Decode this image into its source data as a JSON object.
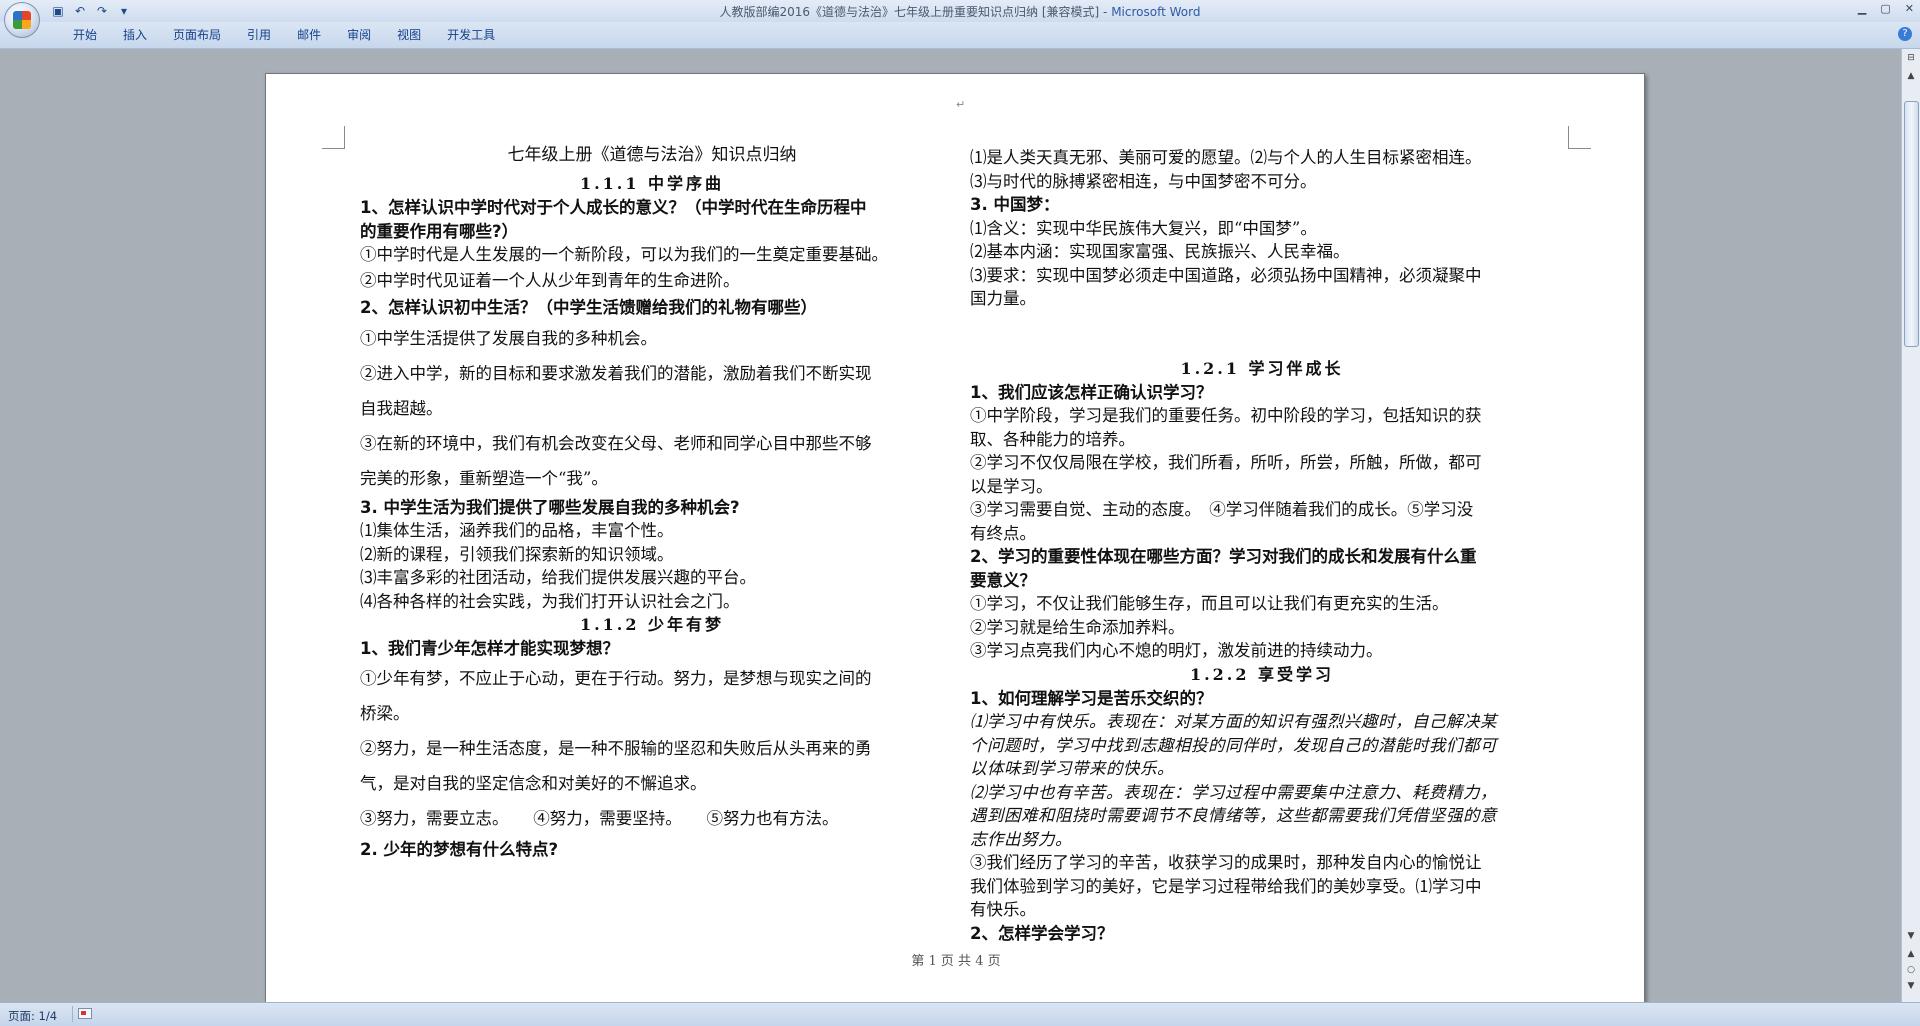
{
  "window": {
    "title": "人教版部编2016《道德与法治》七年级上册重要知识点归纳 [兼容模式] - ",
    "app_name": "Microsoft Word"
  },
  "quick_access": [
    "save-icon",
    "undo-icon",
    "redo-icon",
    "customize-icon"
  ],
  "ribbon": {
    "tabs": [
      "开始",
      "插入",
      "页面布局",
      "引用",
      "邮件",
      "审阅",
      "视图",
      "开发工具"
    ]
  },
  "document": {
    "left_column": [
      {
        "t": "七年级上册《道德与法治》知识点归纳",
        "cls": "doc-title"
      },
      {
        "t": "1.1.1 中学序曲",
        "cls": "sec-h"
      },
      {
        "t": "1、怎样认识中学时代对于个人成长的意义？（中学时代在生命历程中",
        "cls": "ln b"
      },
      {
        "t": "的重要作用有哪些?）",
        "cls": "ln b"
      },
      {
        "t": "①中学时代是人生发展的一个新阶段，可以为我们的一生奠定重要基础。",
        "cls": "ln"
      },
      {
        "t": "②中学时代见证着一个人从少年到青年的生命进阶。",
        "cls": "ln gap-m"
      },
      {
        "t": "2、怎样认识初中生活？（中学生活馈赠给我们的礼物有哪些）",
        "cls": "ln b gap-m"
      },
      {
        "t": "①中学生活提供了发展自我的多种机会。",
        "cls": "ln gap-l"
      },
      {
        "t": "②进入中学，新的目标和要求激发着我们的潜能，激励着我们不断实现",
        "cls": "ln gap-l"
      },
      {
        "t": "自我超越。",
        "cls": "ln gap-l"
      },
      {
        "t": "③在新的环境中，我们有机会改变在父母、老师和同学心目中那些不够",
        "cls": "ln gap-l"
      },
      {
        "t": "完美的形象，重新塑造一个“我”。",
        "cls": "ln gap-l"
      },
      {
        "t": "3. 中学生活为我们提供了哪些发展自我的多种机会?",
        "cls": "ln b"
      },
      {
        "t": "⑴集体生活，涵养我们的品格，丰富个性。",
        "cls": "ln"
      },
      {
        "t": "⑵新的课程，引领我们探索新的知识领域。",
        "cls": "ln"
      },
      {
        "t": "⑶丰富多彩的社团活动，给我们提供发展兴趣的平台。",
        "cls": "ln"
      },
      {
        "t": "⑷各种各样的社会实践，为我们打开认识社会之门。",
        "cls": "ln"
      },
      {
        "t": "1.1.2 少年有梦",
        "cls": "sec-h"
      },
      {
        "t": "1、我们青少年怎样才能实现梦想？",
        "cls": "ln b"
      },
      {
        "t": "①少年有梦，不应止于心动，更在于行动。努力，是梦想与现实之间的",
        "cls": "ln gap-l"
      },
      {
        "t": "桥梁。",
        "cls": "ln gap-l"
      },
      {
        "t": "②努力，是一种生活态度，是一种不服输的坚忍和失败后从头再来的勇",
        "cls": "ln gap-l"
      },
      {
        "t": "气，是对自我的坚定信念和对美好的不懈追求。",
        "cls": "ln gap-l"
      },
      {
        "t": "③努力，需要立志。　　④努力，需要坚持。　　⑤努力也有方法。",
        "cls": "ln gap-l"
      },
      {
        "t": "2. 少年的梦想有什么特点?",
        "cls": "ln b gap-m"
      }
    ],
    "right_column": [
      {
        "t": "⑴是人类天真无邪、美丽可爱的愿望。⑵与个人的人生目标紧密相连。",
        "cls": "ln"
      },
      {
        "t": "⑶与时代的脉搏紧密相连，与中国梦密不可分。",
        "cls": "ln"
      },
      {
        "t": "3. 中国梦：",
        "cls": "ln b"
      },
      {
        "t": "⑴含义：实现中华民族伟大复兴，即“中国梦”。",
        "cls": "ln"
      },
      {
        "t": "⑵基本内涵：实现国家富强、民族振兴、人民幸福。",
        "cls": "ln"
      },
      {
        "t": "⑶要求：实现中国梦必须走中国道路，必须弘扬中国精神，必须凝聚中",
        "cls": "ln"
      },
      {
        "t": "国力量。",
        "cls": "ln"
      },
      {
        "t": "",
        "cls": "ln gap-xl"
      },
      {
        "t": "1.2.1 学习伴成长",
        "cls": "sec-h"
      },
      {
        "t": "1、我们应该怎样正确认识学习？",
        "cls": "ln b"
      },
      {
        "t": "①中学阶段，学习是我们的重要任务。初中阶段的学习，包括知识的获",
        "cls": "ln"
      },
      {
        "t": "取、各种能力的培养。",
        "cls": "ln"
      },
      {
        "t": "②学习不仅仅局限在学校，我们所看，所听，所尝，所触，所做，都可",
        "cls": "ln"
      },
      {
        "t": "以是学习。",
        "cls": "ln"
      },
      {
        "t": "③学习需要自觉、主动的态度。　④学习伴随着我们的成长。⑤学习没",
        "cls": "ln"
      },
      {
        "t": "有终点。",
        "cls": "ln"
      },
      {
        "t": "2、学习的重要性体现在哪些方面？学习对我们的成长和发展有什么重",
        "cls": "ln b"
      },
      {
        "t": "要意义？",
        "cls": "ln b"
      },
      {
        "t": "①学习，不仅让我们能够生存，而且可以让我们有更充实的生活。",
        "cls": "ln"
      },
      {
        "t": "②学习就是给生命添加养料。",
        "cls": "ln"
      },
      {
        "t": "③学习点亮我们内心不熄的明灯，激发前进的持续动力。",
        "cls": "ln"
      },
      {
        "t": "1.2.2 享受学习",
        "cls": "sec-h"
      },
      {
        "t": " 1、如何理解学习是苦乐交织的？",
        "cls": "ln b"
      },
      {
        "t": " ⑴学习中有快乐。表现在：对某方面的知识有强烈兴趣时，自己解决某",
        "cls": "ln ital"
      },
      {
        "t": "个问题时，学习中找到志趣相投的同伴时，发现自己的潜能时我们都可",
        "cls": "ln ital"
      },
      {
        "t": "以体味到学习带来的快乐。",
        "cls": "ln ital"
      },
      {
        "t": " ⑵学习中也有辛苦。表现在：学习过程中需要集中注意力、耗费精力，",
        "cls": "ln ital"
      },
      {
        "t": "遇到困难和阻挠时需要调节不良情绪等，这些都需要我们凭借坚强的意",
        "cls": "ln ital"
      },
      {
        "t": "志作出努力。",
        "cls": "ln ital"
      },
      {
        "t": " ③我们经历了学习的辛苦，收获学习的成果时，那种发自内心的愉悦让",
        "cls": "ln"
      },
      {
        "t": "我们体验到学习的美好，它是学习过程带给我们的美妙享受。⑴学习中",
        "cls": "ln"
      },
      {
        "t": "有快乐。",
        "cls": "ln"
      },
      {
        "t": "2、怎样学会学习？",
        "cls": "ln b"
      }
    ],
    "footer": "第 1 页 共 4 页"
  },
  "statusbar": {
    "page_indicator": "页面: 1/4"
  }
}
